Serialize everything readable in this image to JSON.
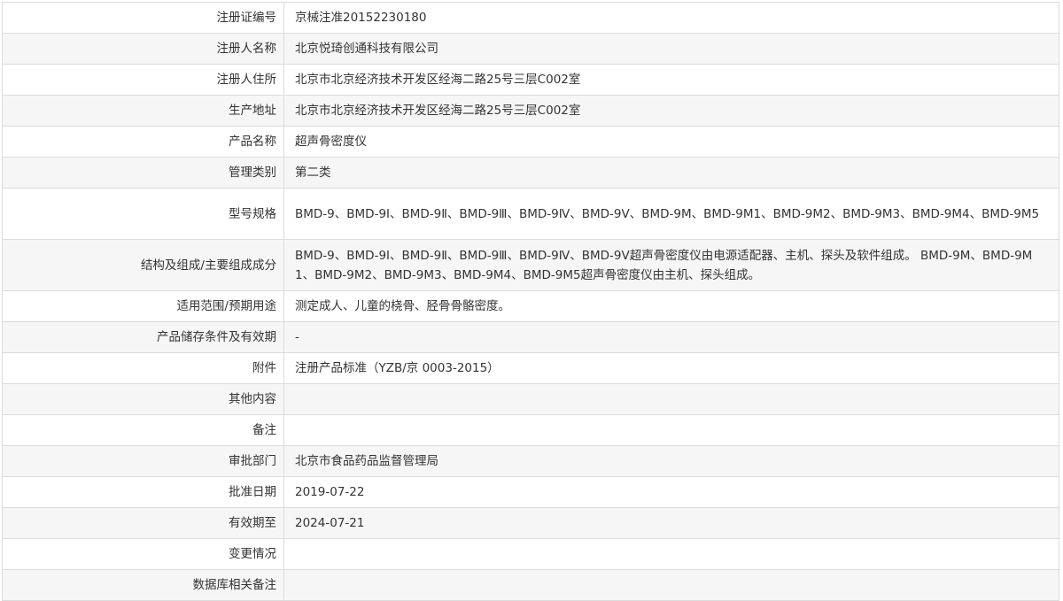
{
  "record": {
    "rows": [
      {
        "label": "注册证编号",
        "value": "京械注准20152230180"
      },
      {
        "label": "注册人名称",
        "value": "北京悦琦创通科技有限公司"
      },
      {
        "label": "注册人住所",
        "value": "北京市北京经济技术开发区经海二路25号三层C002室"
      },
      {
        "label": "生产地址",
        "value": "北京市北京经济技术开发区经海二路25号三层C002室"
      },
      {
        "label": "产品名称",
        "value": "超声骨密度仪"
      },
      {
        "label": "管理类别",
        "value": "第二类"
      },
      {
        "label": "型号规格",
        "value": "BMD-9、BMD-9Ⅰ、BMD-9Ⅱ、BMD-9Ⅲ、BMD-9Ⅳ、BMD-9Ⅴ、BMD-9M、BMD-9M1、BMD-9M2、BMD-9M3、BMD-9M4、BMD-9M5"
      },
      {
        "label": "结构及组成/主要组成成分",
        "value": "BMD-9、BMD-9Ⅰ、BMD-9Ⅱ、BMD-9Ⅲ、BMD-9Ⅳ、BMD-9Ⅴ超声骨密度仪由电源适配器、主机、探头及软件组成。 BMD-9M、BMD-9M1、BMD-9M2、BMD-9M3、BMD-9M4、BMD-9M5超声骨密度仪由主机、探头组成。"
      },
      {
        "label": "适用范围/预期用途",
        "value": "测定成人、儿童的桡骨、胫骨骨骼密度。"
      },
      {
        "label": "产品储存条件及有效期",
        "value": "-"
      },
      {
        "label": "附件",
        "value": "注册产品标准（YZB/京 0003-2015）"
      },
      {
        "label": "其他内容",
        "value": ""
      },
      {
        "label": "备注",
        "value": ""
      },
      {
        "label": "审批部门",
        "value": "北京市食品药品监督管理局"
      },
      {
        "label": "批准日期",
        "value": "2019-07-22"
      },
      {
        "label": "有效期至",
        "value": "2024-07-21"
      },
      {
        "label": "变更情况",
        "value": ""
      },
      {
        "label": "数据库相关备注",
        "value": ""
      }
    ]
  }
}
